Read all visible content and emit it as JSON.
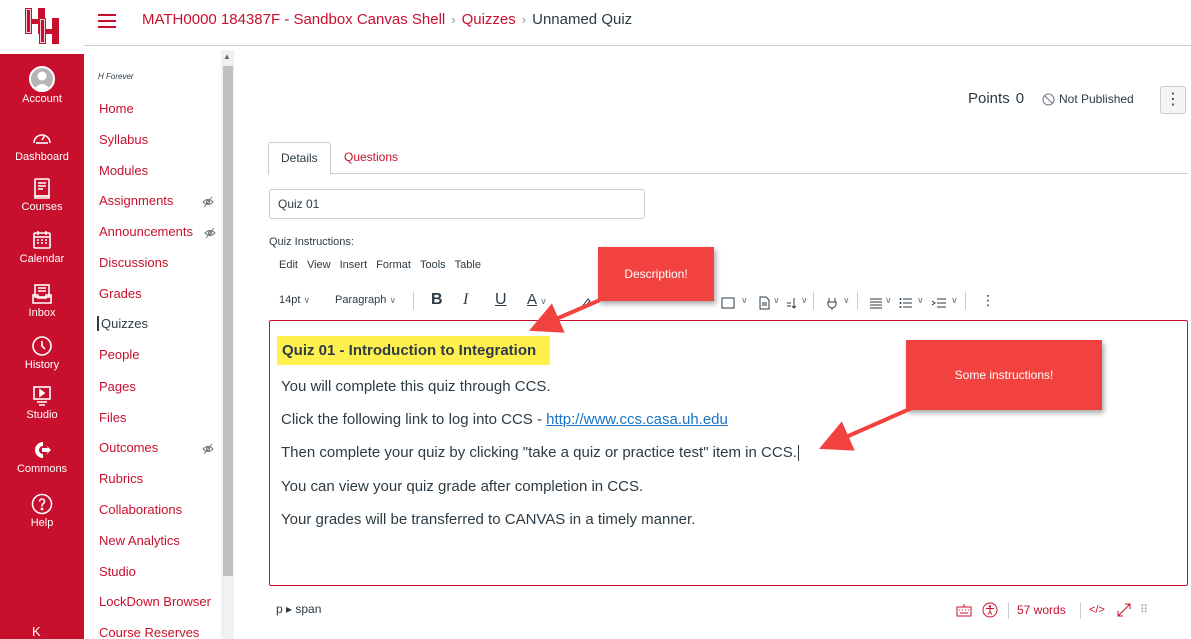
{
  "brand": {
    "logo_text": "UH",
    "primary_color": "#c8102e",
    "link_color": "#1a73c6",
    "highlight_color": "#fff04e"
  },
  "global_nav": {
    "items": [
      {
        "label": "Account",
        "icon": "account-avatar-icon"
      },
      {
        "label": "Dashboard",
        "icon": "dashboard-gauge-icon"
      },
      {
        "label": "Courses",
        "icon": "courses-book-icon"
      },
      {
        "label": "Calendar",
        "icon": "calendar-icon"
      },
      {
        "label": "Inbox",
        "icon": "inbox-icon"
      },
      {
        "label": "History",
        "icon": "history-clock-icon"
      },
      {
        "label": "Studio",
        "icon": "studio-icon"
      },
      {
        "label": "Commons",
        "icon": "commons-icon"
      },
      {
        "label": "Help",
        "icon": "help-icon"
      }
    ],
    "collapse_glyph": "K"
  },
  "header": {
    "breadcrumb": {
      "course": "MATH0000 184387F - Sandbox Canvas Shell",
      "section": "Quizzes",
      "current": "Unnamed Quiz",
      "separator": "›"
    }
  },
  "course_nav": {
    "subtitle": "H Forever",
    "items": [
      {
        "label": "Home"
      },
      {
        "label": "Syllabus"
      },
      {
        "label": "Modules"
      },
      {
        "label": "Assignments"
      },
      {
        "label": "Announcements"
      },
      {
        "label": "Discussions"
      },
      {
        "label": "Grades"
      },
      {
        "label": "Quizzes"
      },
      {
        "label": "People"
      },
      {
        "label": "Pages"
      },
      {
        "label": "Files"
      },
      {
        "label": "Outcomes"
      },
      {
        "label": "Rubrics"
      },
      {
        "label": "Collaborations"
      },
      {
        "label": "New Analytics"
      },
      {
        "label": "Studio"
      },
      {
        "label": "LockDown Browser"
      },
      {
        "label": "Course Reserves"
      }
    ],
    "active": "Quizzes"
  },
  "quiz_header": {
    "points_label": "Points",
    "points_value": "0",
    "publish_state": "Not Published",
    "options_glyph": "⋮"
  },
  "tabs": {
    "details": "Details",
    "questions": "Questions",
    "active": "Details"
  },
  "form": {
    "title_value": "Quiz 01",
    "instructions_label": "Quiz Instructions:"
  },
  "editor": {
    "menubar": [
      "Edit",
      "View",
      "Insert",
      "Format",
      "Tools",
      "Table"
    ],
    "toolbar": {
      "font_size": "14pt",
      "block_format": "Paragraph",
      "bold": "B",
      "italic": "I",
      "underline": "U",
      "text_color": "A"
    },
    "content": {
      "heading": "Quiz 01 - Introduction to Integration",
      "p1": "You will complete this quiz through CCS.",
      "p2_text": "Click the following link to log into CCS - ",
      "p2_link": "http://www.ccs.casa.uh.edu",
      "p3": "Then complete your quiz by clicking \"take a quiz or practice test\" item in CCS.",
      "p4": "You can view your quiz grade after completion in CCS.",
      "p5": "Your grades will be transferred to CANVAS in a timely manner."
    },
    "status": {
      "path": "p ▸ span",
      "word_count": "57 words",
      "html_toggle": "</>"
    }
  },
  "callouts": {
    "description": "Description!",
    "instructions": "Some instructions!"
  }
}
